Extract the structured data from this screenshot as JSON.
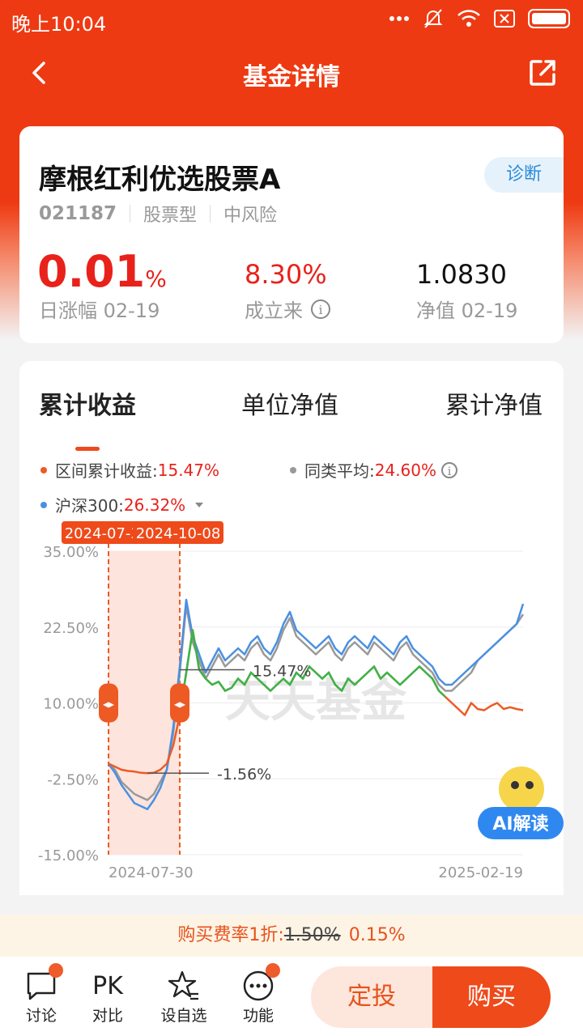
{
  "status": {
    "time": "晚上10:04"
  },
  "nav": {
    "title": "基金详情"
  },
  "fund": {
    "name": "摩根红利优选股票A",
    "code": "021187",
    "type": "股票型",
    "risk": "中风险",
    "diagnose": "诊断",
    "daily_change": "0.01",
    "daily_change_unit": "%",
    "daily_change_label": "日涨幅 02-19",
    "since_inception": "8.30%",
    "since_inception_label": "成立来",
    "nav_value": "1.0830",
    "nav_label": "净值 02-19"
  },
  "tabs": [
    "累计收益",
    "单位净值",
    "累计净值"
  ],
  "legend": {
    "fund_label": "区间累计收益:",
    "fund_value": "15.47%",
    "peer_label": "同类平均:",
    "peer_value": "24.60%",
    "index_label": "沪深300:",
    "index_value": "26.32%"
  },
  "range_tags": {
    "start": "2024-07-30",
    "end": "2024-10-08"
  },
  "watermark": "天天基金",
  "ai_label": "AI解读",
  "colors": {
    "primary": "#ee3a12",
    "fund": "#ee5a24",
    "peer": "#999999",
    "index": "#4a90e2",
    "highlight": "#39b54a"
  },
  "chart_data": {
    "type": "line",
    "x_labels": [
      "2024-07-30",
      "2025-02-19"
    ],
    "yticks": [
      "35.00%",
      "22.50%",
      "10.00%",
      "-2.50%",
      "-15.00%"
    ],
    "ylim": [
      -15,
      35
    ],
    "annotations": [
      "15.47%",
      "-1.56%"
    ],
    "series": [
      {
        "name": "区间累计收益",
        "values": [
          0,
          -0.5,
          -1,
          -1.2,
          -1.3,
          -1.5,
          -1.56,
          -1.5,
          -1,
          0,
          3,
          8,
          15,
          22,
          15.47,
          14,
          13,
          13.5,
          12,
          12.5,
          14,
          13,
          15,
          14,
          13,
          12,
          13,
          14,
          13,
          15,
          14,
          16,
          15,
          14,
          15,
          13,
          12,
          14,
          13,
          14,
          15,
          16,
          14,
          15,
          14,
          13,
          14,
          15,
          16,
          15,
          14,
          12,
          11,
          10,
          9,
          8,
          10,
          9,
          8.8,
          9.5,
          10,
          9,
          9.3,
          9,
          8.8
        ]
      },
      {
        "name": "同类平均",
        "values": [
          0,
          -1,
          -3,
          -4,
          -5,
          -5.5,
          -6,
          -5,
          -3,
          -1,
          5,
          15,
          26,
          20,
          17,
          14,
          16,
          18,
          16,
          17,
          18,
          17,
          19,
          20,
          18,
          17,
          19,
          22,
          24,
          21,
          20,
          19,
          18,
          19,
          20,
          18,
          17,
          19,
          20,
          19,
          18,
          20,
          19,
          18,
          17,
          19,
          20,
          18,
          17,
          16,
          15,
          13,
          12,
          12,
          13,
          14,
          15,
          17,
          18,
          19,
          20,
          21,
          22,
          23,
          24.6
        ]
      },
      {
        "name": "沪深300",
        "values": [
          0,
          -1.5,
          -3.5,
          -5,
          -6.5,
          -7,
          -7.5,
          -6,
          -4,
          -1,
          6,
          16,
          27,
          21,
          18,
          15,
          17,
          19,
          17,
          18,
          19,
          18,
          20,
          21,
          19,
          18,
          20,
          23,
          25,
          22,
          21,
          20,
          19,
          20,
          21,
          19,
          18,
          20,
          21,
          20,
          19,
          21,
          20,
          19,
          18,
          20,
          21,
          19,
          18,
          17,
          16,
          14,
          13,
          13,
          14,
          15,
          16,
          17,
          18,
          19,
          20,
          21,
          22,
          23,
          26.32
        ]
      }
    ]
  },
  "fee": {
    "label": "购买费率1折:",
    "original": "1.50%",
    "discount": "0.15%"
  },
  "bottom": {
    "items": [
      "讨论",
      "PK",
      "对比",
      "设自选",
      "功能"
    ],
    "dingtou": "定投",
    "buy": "购买"
  }
}
